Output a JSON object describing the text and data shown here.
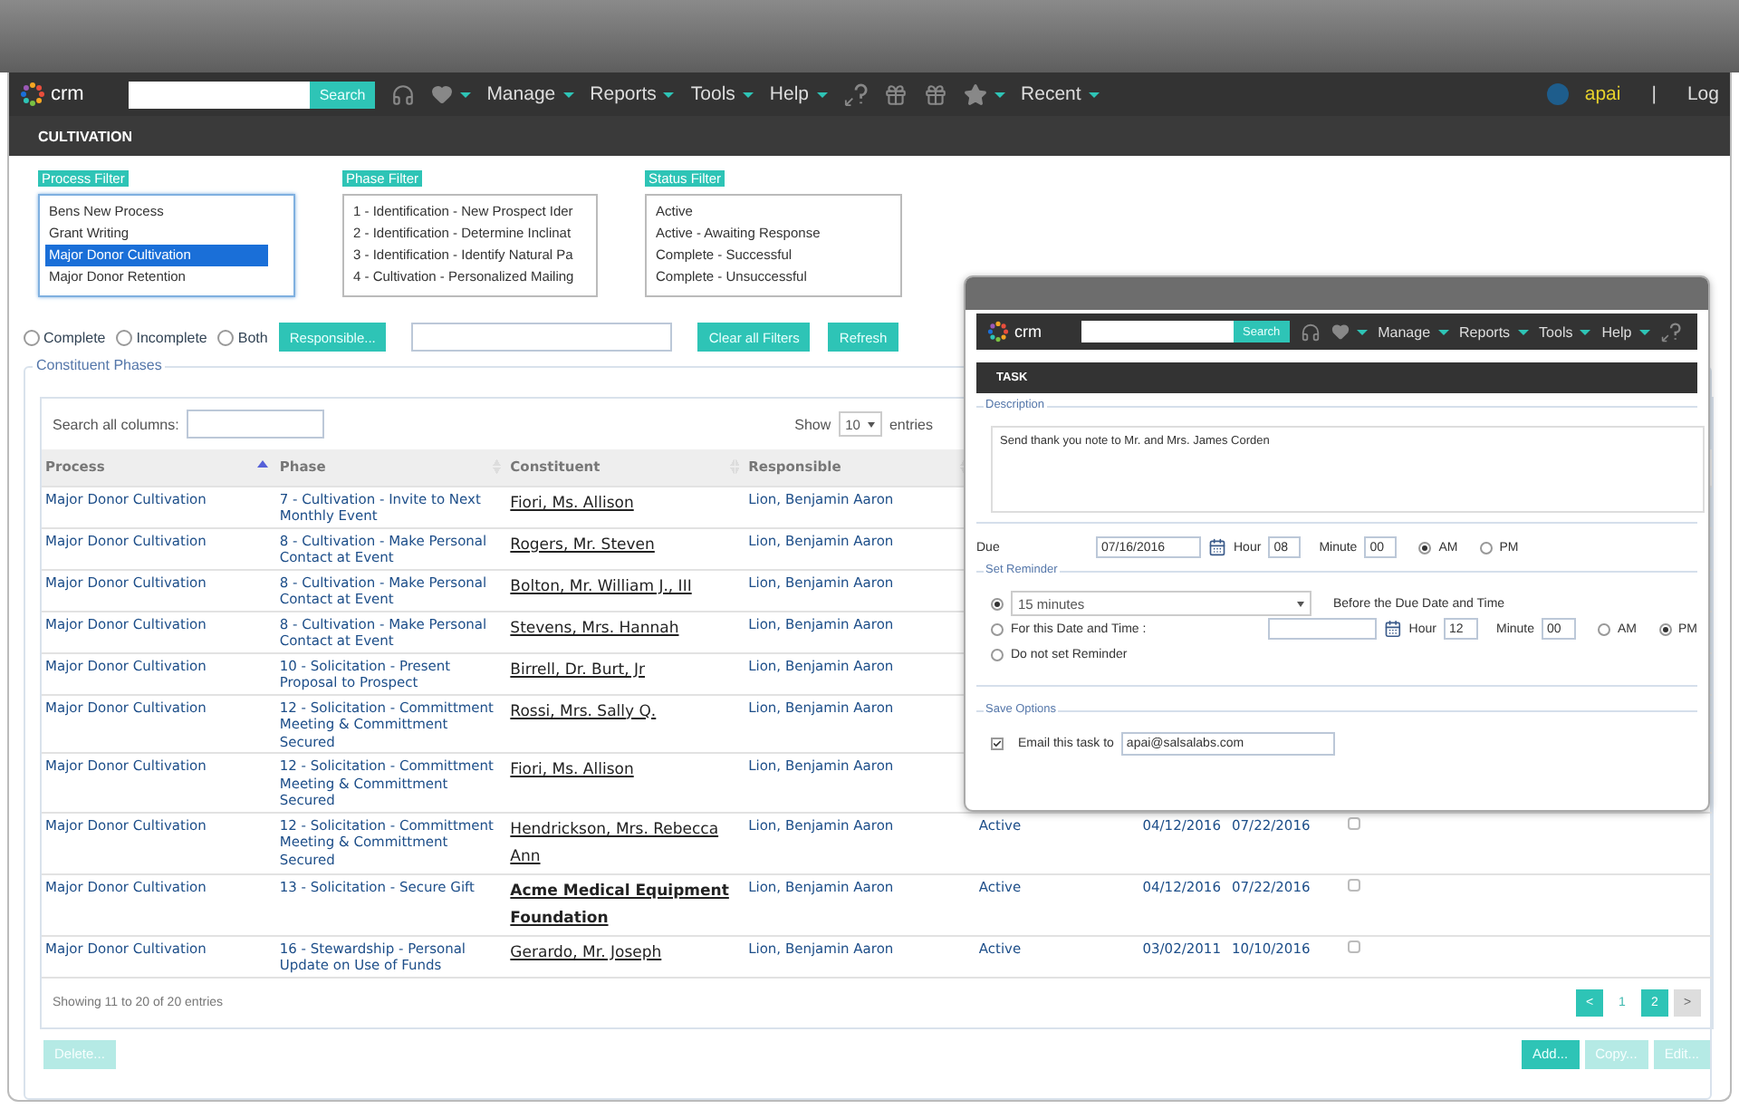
{
  "app_nav": {
    "logo": "crm",
    "search_button": "Search",
    "menus": [
      "Manage",
      "Reports",
      "Tools",
      "Help"
    ],
    "recent": "Recent",
    "user": "apai",
    "divider": "|",
    "logout": "Log"
  },
  "page_title": "CULTIVATION",
  "filters": [
    {
      "label": "Process Filter",
      "focused": true,
      "options": [
        {
          "label": "Bens New Process",
          "selected": false
        },
        {
          "label": "Grant Writing",
          "selected": false
        },
        {
          "label": "Major Donor Cultivation",
          "selected": true
        },
        {
          "label": "Major Donor Retention",
          "selected": false
        }
      ]
    },
    {
      "label": "Phase Filter",
      "focused": false,
      "options": [
        {
          "label": "1 - Identification - New Prospect Ider",
          "selected": false
        },
        {
          "label": "2 - Identification - Determine Inclinat",
          "selected": false
        },
        {
          "label": "3 - Identification - Identify Natural Pa",
          "selected": false
        },
        {
          "label": "4 - Cultivation - Personalized Mailing",
          "selected": false
        }
      ]
    },
    {
      "label": "Status Filter",
      "focused": false,
      "options": [
        {
          "label": "Active",
          "selected": false
        },
        {
          "label": "Active - Awaiting Response",
          "selected": false
        },
        {
          "label": "Complete - Successful",
          "selected": false
        },
        {
          "label": "Complete - Unsuccessful",
          "selected": false
        }
      ]
    }
  ],
  "completion_options": [
    {
      "label": "Complete",
      "selected": false
    },
    {
      "label": "Incomplete",
      "selected": false
    },
    {
      "label": "Both",
      "selected": false
    }
  ],
  "responsible_button": "Responsible...",
  "clear_button": "Clear all Filters",
  "refresh_button": "Refresh",
  "section_title": "Constituent Phases",
  "table": {
    "search_label": "Search all columns:",
    "show_label": "Show",
    "page_size": "10",
    "entries_label": "entries",
    "columns": [
      {
        "label": "Process",
        "sorted": true
      },
      {
        "label": "Phase",
        "sorted": false
      },
      {
        "label": "Constituent",
        "sorted": false
      },
      {
        "label": "Responsible",
        "sorted": false
      }
    ],
    "rows": [
      {
        "process": "Major Donor Cultivation",
        "phase": "7 - Cultivation - Invite to Next Monthly Event",
        "constituent": "Fiori, Ms. Allison",
        "bold": false,
        "responsible": "Lion, Benjamin Aaron"
      },
      {
        "process": "Major Donor Cultivation",
        "phase": "8 - Cultivation - Make Personal Contact at Event",
        "constituent": "Rogers, Mr. Steven",
        "bold": false,
        "responsible": "Lion, Benjamin Aaron"
      },
      {
        "process": "Major Donor Cultivation",
        "phase": "8 - Cultivation - Make Personal Contact at Event",
        "constituent": "Bolton, Mr. William J., III",
        "bold": false,
        "responsible": "Lion, Benjamin Aaron"
      },
      {
        "process": "Major Donor Cultivation",
        "phase": "8 - Cultivation - Make Personal Contact at Event",
        "constituent": "Stevens, Mrs. Hannah",
        "bold": false,
        "responsible": "Lion, Benjamin Aaron"
      },
      {
        "process": "Major Donor Cultivation",
        "phase": "10 - Solicitation - Present Proposal to Prospect",
        "constituent": "Birrell, Dr. Burt, Jr",
        "bold": false,
        "responsible": "Lion, Benjamin Aaron"
      },
      {
        "process": "Major Donor Cultivation",
        "phase": "12 - Solicitation - Committment Meeting & Committment Secured",
        "constituent": "Rossi, Mrs. Sally Q.",
        "bold": false,
        "responsible": "Lion, Benjamin Aaron"
      },
      {
        "process": "Major Donor Cultivation",
        "phase": "12 - Solicitation - Committment Meeting & Committment Secured",
        "constituent": "Fiori, Ms. Allison",
        "bold": false,
        "responsible": "Lion, Benjamin Aaron"
      },
      {
        "process": "Major Donor Cultivation",
        "phase": "12 - Solicitation - Committment Meeting & Committment Secured",
        "constituent": "Hendrickson, Mrs. Rebecca Ann",
        "bold": false,
        "responsible": "Lion, Benjamin Aaron",
        "column_5": "Active",
        "column_6": "04/12/2016",
        "column_7": "07/22/2016",
        "checked": false
      },
      {
        "process": "Major Donor Cultivation",
        "phase": "13 - Solicitation - Secure Gift",
        "constituent": "Acme Medical Equipment Foundation",
        "bold": true,
        "responsible": "Lion, Benjamin Aaron",
        "column_5": "Active",
        "column_6": "04/12/2016",
        "column_7": "07/22/2016",
        "checked": false
      },
      {
        "process": "Major Donor Cultivation",
        "phase": "16 - Stewardship - Personal Update on Use of Funds",
        "constituent": "Gerardo, Mr. Joseph",
        "bold": false,
        "responsible": "Lion, Benjamin Aaron",
        "column_5": "Active",
        "column_6": "03/02/2011",
        "column_7": "10/10/2016",
        "checked": false
      }
    ],
    "info": "Showing 11 to 20 of 20 entries",
    "prev": "<",
    "next": ">",
    "pages": [
      {
        "label": "1",
        "selected": false
      },
      {
        "label": "2",
        "selected": true
      }
    ]
  },
  "delete_button": {
    "label": "Delete...",
    "disabled": true
  },
  "buttons": [
    {
      "label": "Add...",
      "disabled": false
    },
    {
      "label": "Copy...",
      "disabled": true
    },
    {
      "label": "Edit...",
      "disabled": true
    }
  ],
  "task_dialog": {
    "nav": {
      "logo": "crm",
      "search_button": "Search",
      "menus": [
        "Manage",
        "Reports",
        "Tools",
        "Help"
      ]
    },
    "title": "TASK",
    "description_label": "Description",
    "description": "Send thank you note to Mr. and Mrs. James Corden",
    "due_label": "Due",
    "due_date": "07/16/2016",
    "hour_label": "Hour",
    "hour": "08",
    "minute_label": "Minute",
    "minute": "00",
    "am_pm": [
      {
        "label": "AM",
        "selected": true
      },
      {
        "label": "PM",
        "selected": false
      }
    ],
    "reminder_label": "Set Reminder",
    "reminder_options": [
      {
        "kind": "select",
        "selected": true,
        "value": "15 minutes",
        "suffix": "Before the Due Date and Time"
      },
      {
        "kind": "datetime",
        "selected": false,
        "label": "For this Date and Time :",
        "hour_label": "Hour",
        "hour": "12",
        "minute_label": "Minute",
        "minute": "00",
        "am_pm": [
          {
            "label": "AM",
            "selected": false
          },
          {
            "label": "PM",
            "selected": true
          }
        ]
      },
      {
        "kind": "none",
        "selected": false,
        "label": "Do not set Reminder"
      }
    ],
    "save_label": "Save Options",
    "email": {
      "checked": true,
      "label": "Email this task to",
      "value": "apai@salsalabs.com"
    }
  }
}
